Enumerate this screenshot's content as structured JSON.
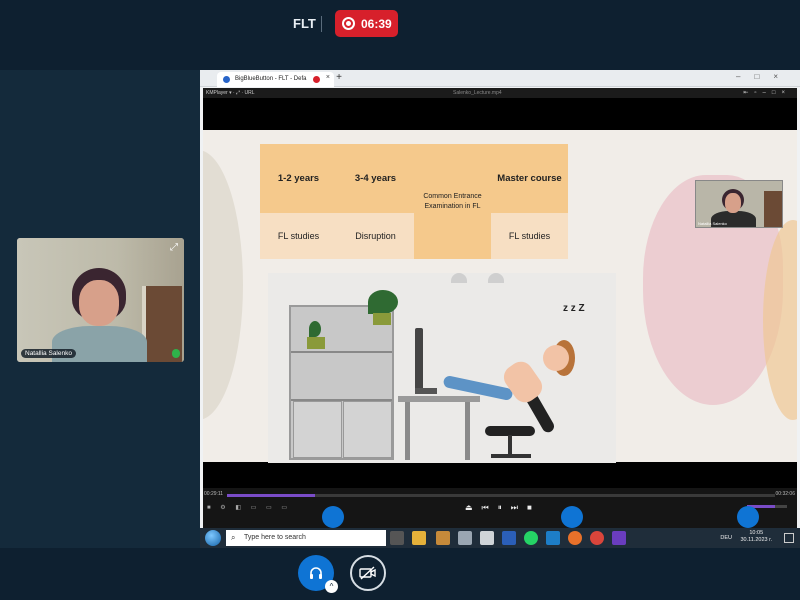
{
  "header": {
    "meeting_title": "FLT",
    "recording_time": "06:39"
  },
  "webcam": {
    "participant_name": "Natallia Salenko"
  },
  "browser": {
    "tab_title": "BigBlueButton - FLT - Defa",
    "new_tab": "+"
  },
  "player": {
    "app_name": "KMPlayer",
    "menu_url": "URL",
    "file_name": "Salenko_Lecture.mp4",
    "time_elapsed": "00:29:11",
    "time_total": "00:32:06",
    "seek_progress": 0.16,
    "volume_level": 0.7,
    "accent": "#7a4cc8"
  },
  "slide": {
    "table": {
      "headers": [
        "1-2 years",
        "3-4 years",
        "Common Entrance Examination in FL",
        "Master course"
      ],
      "sub": [
        "FL studies",
        "Disruption",
        "",
        "FL studies"
      ]
    },
    "sleep_text": "z z Z",
    "presenter_label": "Natallia Salenko"
  },
  "taskbar": {
    "search_placeholder": "Type here to search",
    "language": "DEU",
    "time": "10:05",
    "date": "30.11.2023 г."
  },
  "colors": {
    "record": "#d7202b",
    "primary": "#0f74d4",
    "background": "#0f2233"
  }
}
